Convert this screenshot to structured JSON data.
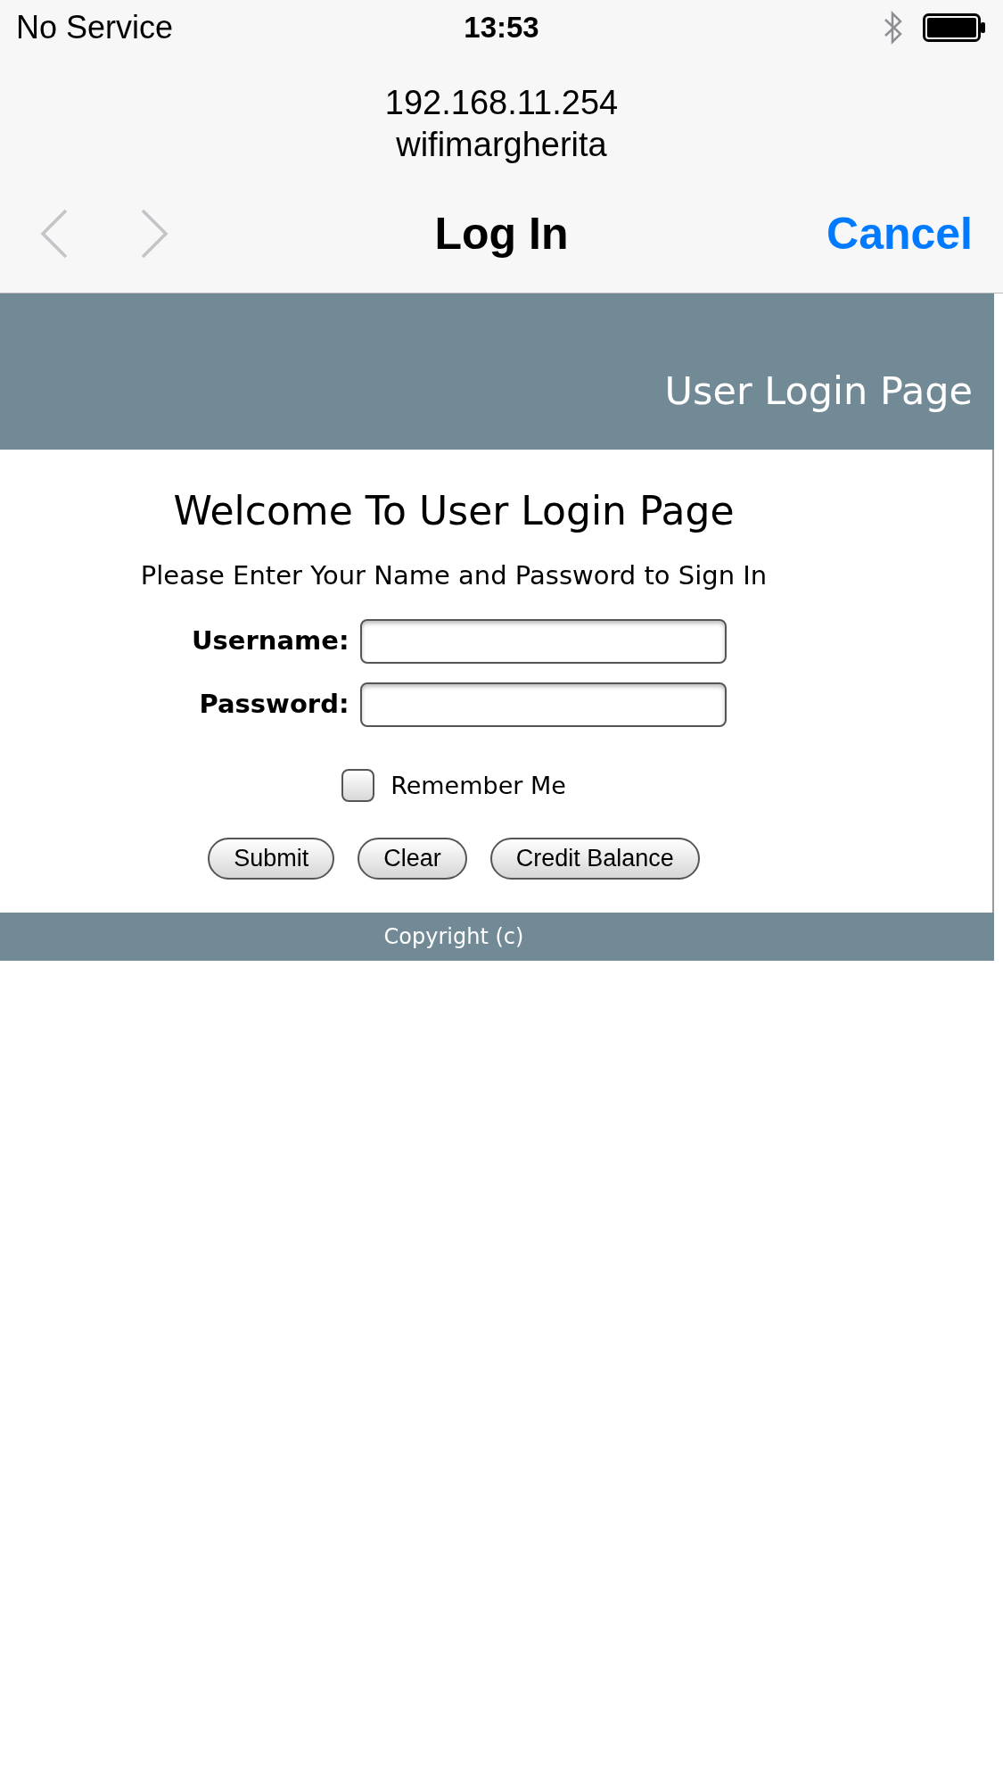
{
  "status_bar": {
    "carrier": "No Service",
    "time": "13:53"
  },
  "address": {
    "host": "192.168.11.254",
    "network": "wifimargherita"
  },
  "nav": {
    "back": {
      "disabled": true
    },
    "forward": {
      "disabled": true
    },
    "title": "Log In",
    "cancel": "Cancel"
  },
  "page": {
    "header": "User Login Page",
    "title": "Welcome To User Login Page",
    "subtitle": "Please Enter Your Name and Password to Sign In",
    "fields": [
      {
        "label": "Username:"
      },
      {
        "label": "Password:"
      }
    ],
    "remember": {
      "label": "Remember Me",
      "checked": false
    },
    "buttons": [
      "Submit",
      "Clear",
      "Credit Balance"
    ],
    "footer": "Copyright (c)"
  }
}
